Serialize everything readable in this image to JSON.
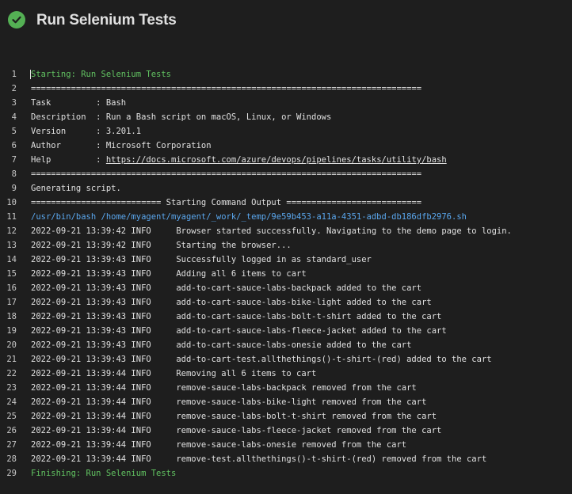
{
  "header": {
    "status_icon": "check-circle-icon",
    "title": "Run Selenium Tests",
    "status_color": "#54b054"
  },
  "log": {
    "lines": [
      {
        "n": "1",
        "text": "Starting: Run Selenium Tests",
        "style": "green"
      },
      {
        "n": "2",
        "text": "==============================================================================",
        "style": ""
      },
      {
        "n": "3",
        "text": "Task         : Bash",
        "style": ""
      },
      {
        "n": "4",
        "text": "Description  : Run a Bash script on macOS, Linux, or Windows",
        "style": ""
      },
      {
        "n": "5",
        "text": "Version      : 3.201.1",
        "style": ""
      },
      {
        "n": "6",
        "text": "Author       : Microsoft Corporation",
        "style": ""
      },
      {
        "n": "7",
        "text": "Help         : ",
        "link": "https://docs.microsoft.com/azure/devops/pipelines/tasks/utility/bash",
        "style": ""
      },
      {
        "n": "8",
        "text": "==============================================================================",
        "style": ""
      },
      {
        "n": "9",
        "text": "Generating script.",
        "style": ""
      },
      {
        "n": "10",
        "text": "========================== Starting Command Output ===========================",
        "style": ""
      },
      {
        "n": "11",
        "text": "/usr/bin/bash /home/myagent/myagent/_work/_temp/9e59b453-a11a-4351-adbd-db186dfb2976.sh",
        "style": "blue"
      },
      {
        "n": "12",
        "text": "2022-09-21 13:39:42 INFO     Browser started successfully. Navigating to the demo page to login.",
        "style": ""
      },
      {
        "n": "13",
        "text": "2022-09-21 13:39:42 INFO     Starting the browser...",
        "style": ""
      },
      {
        "n": "14",
        "text": "2022-09-21 13:39:43 INFO     Successfully logged in as standard_user",
        "style": ""
      },
      {
        "n": "15",
        "text": "2022-09-21 13:39:43 INFO     Adding all 6 items to cart",
        "style": ""
      },
      {
        "n": "16",
        "text": "2022-09-21 13:39:43 INFO     add-to-cart-sauce-labs-backpack added to the cart",
        "style": ""
      },
      {
        "n": "17",
        "text": "2022-09-21 13:39:43 INFO     add-to-cart-sauce-labs-bike-light added to the cart",
        "style": ""
      },
      {
        "n": "18",
        "text": "2022-09-21 13:39:43 INFO     add-to-cart-sauce-labs-bolt-t-shirt added to the cart",
        "style": ""
      },
      {
        "n": "19",
        "text": "2022-09-21 13:39:43 INFO     add-to-cart-sauce-labs-fleece-jacket added to the cart",
        "style": ""
      },
      {
        "n": "20",
        "text": "2022-09-21 13:39:43 INFO     add-to-cart-sauce-labs-onesie added to the cart",
        "style": ""
      },
      {
        "n": "21",
        "text": "2022-09-21 13:39:43 INFO     add-to-cart-test.allthethings()-t-shirt-(red) added to the cart",
        "style": ""
      },
      {
        "n": "22",
        "text": "2022-09-21 13:39:44 INFO     Removing all 6 items to cart",
        "style": ""
      },
      {
        "n": "23",
        "text": "2022-09-21 13:39:44 INFO     remove-sauce-labs-backpack removed from the cart",
        "style": ""
      },
      {
        "n": "24",
        "text": "2022-09-21 13:39:44 INFO     remove-sauce-labs-bike-light removed from the cart",
        "style": ""
      },
      {
        "n": "25",
        "text": "2022-09-21 13:39:44 INFO     remove-sauce-labs-bolt-t-shirt removed from the cart",
        "style": ""
      },
      {
        "n": "26",
        "text": "2022-09-21 13:39:44 INFO     remove-sauce-labs-fleece-jacket removed from the cart",
        "style": ""
      },
      {
        "n": "27",
        "text": "2022-09-21 13:39:44 INFO     remove-sauce-labs-onesie removed from the cart",
        "style": ""
      },
      {
        "n": "28",
        "text": "2022-09-21 13:39:44 INFO     remove-test.allthethings()-t-shirt-(red) removed from the cart",
        "style": ""
      },
      {
        "n": "29",
        "text": "Finishing: Run Selenium Tests",
        "style": "green"
      }
    ]
  }
}
